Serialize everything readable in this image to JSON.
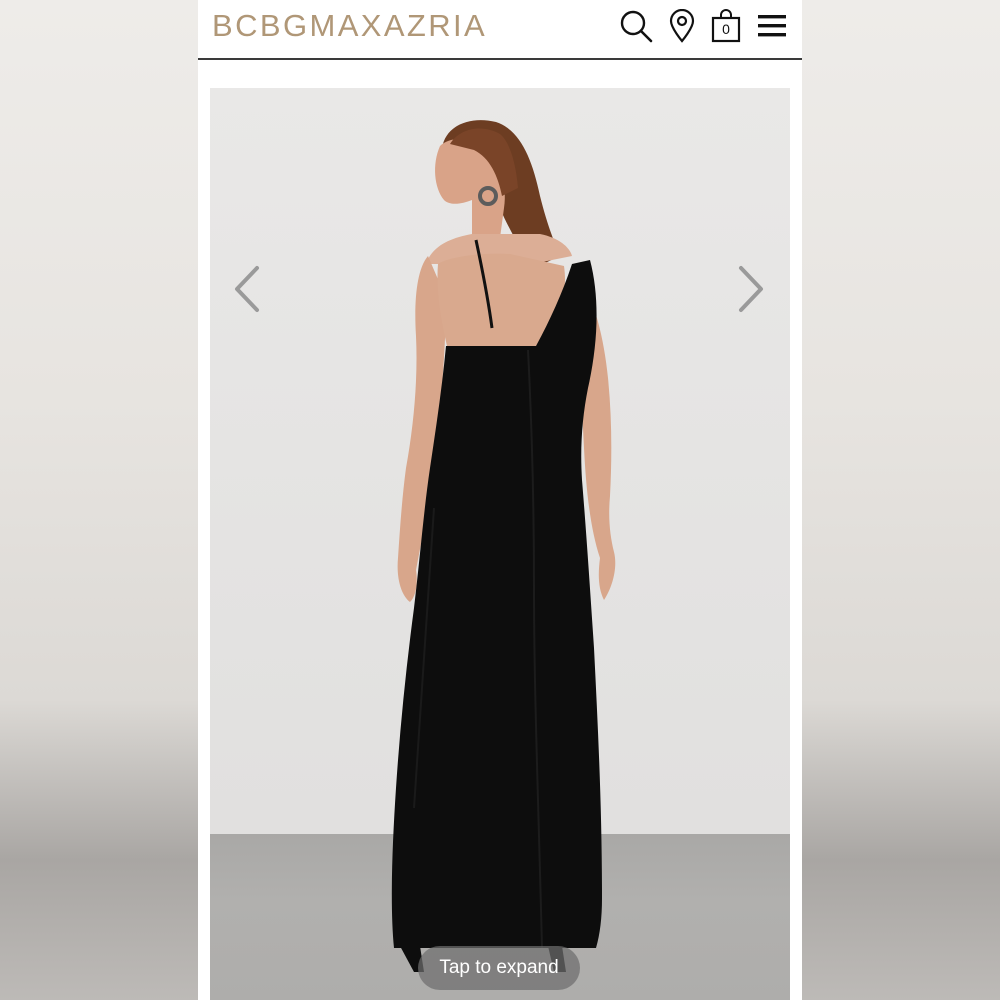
{
  "header": {
    "logo_prefix": "BCBG",
    "logo_suffix": "MAXAZRIA",
    "icons": [
      "search-icon",
      "location-pin-icon",
      "shopping-bag-icon",
      "menu-icon"
    ],
    "bag_count": "0"
  },
  "gallery": {
    "prev_icon": "chevron-left-icon",
    "next_icon": "chevron-right-icon",
    "expand_label": "Tap to expand"
  },
  "colors": {
    "logo_gold": "#b09777",
    "dress": "#0d0d0d"
  }
}
